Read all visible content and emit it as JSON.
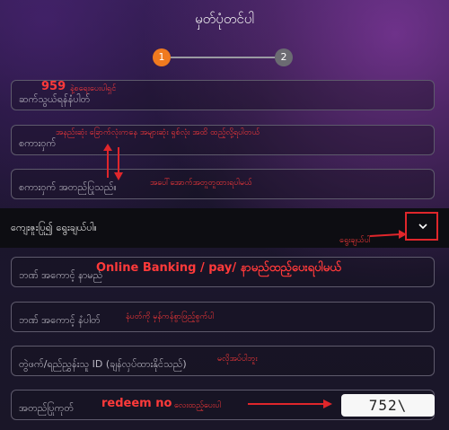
{
  "header": {
    "title": "မှတ်ပုံတင်ပါ"
  },
  "steps": [
    "1",
    "2"
  ],
  "form": {
    "phone_placeholder": "ဆက်သွယ်ရန်နံပါတ်",
    "password_placeholder": "စကားဝှက်",
    "confirm_placeholder": "စကားဝှက် အတည်ပြုသည်။",
    "bank_select_placeholder": "ကျေးဇူးပြု၍ ရွေးချယ်ပါ။",
    "account_name_placeholder": "ဘဏ် အကောင့် နာမည်",
    "account_number_placeholder": "ဘဏ် အကောင့် နံပါတ်",
    "referral_placeholder": "တွဲဖက်/ရည်ညွှန်းသူ ID (ချန်လှပ်ထားနိုင်သည်)",
    "verify_placeholder": "အတည်ပြုကုတ်",
    "captcha_text": "752\\"
  },
  "annotations": {
    "phone_note_number": "959",
    "phone_note_text": "နဲ့စရေးပေးပါရှင်",
    "password_note": "အနည်းဆုံး ခြောက်လုံးကနေ အများဆုံး ရှစ်လုံး အထိ ထည့်လို့ရပါတယ်",
    "confirm_note": "အပေါ်အောက်အတူတူထားရပါမယ်",
    "select_note": "ရွေးချယ်ပါ",
    "account_name_note": "Online Banking /  pay/ နာမည်ထည့်ပေးရပါမယ်",
    "account_number_note": "နံပတ်ကို မှန်ကန်စွာဖြည့်စွက်ပါ",
    "referral_note": "မလိုအပ်ပါဘူး",
    "verify_note_bold": "redeem no",
    "verify_note_text": "လေးထည့်ပေးပါ"
  },
  "colors": {
    "accent": "#f07a1f",
    "annotation": "#ff3a3a"
  }
}
